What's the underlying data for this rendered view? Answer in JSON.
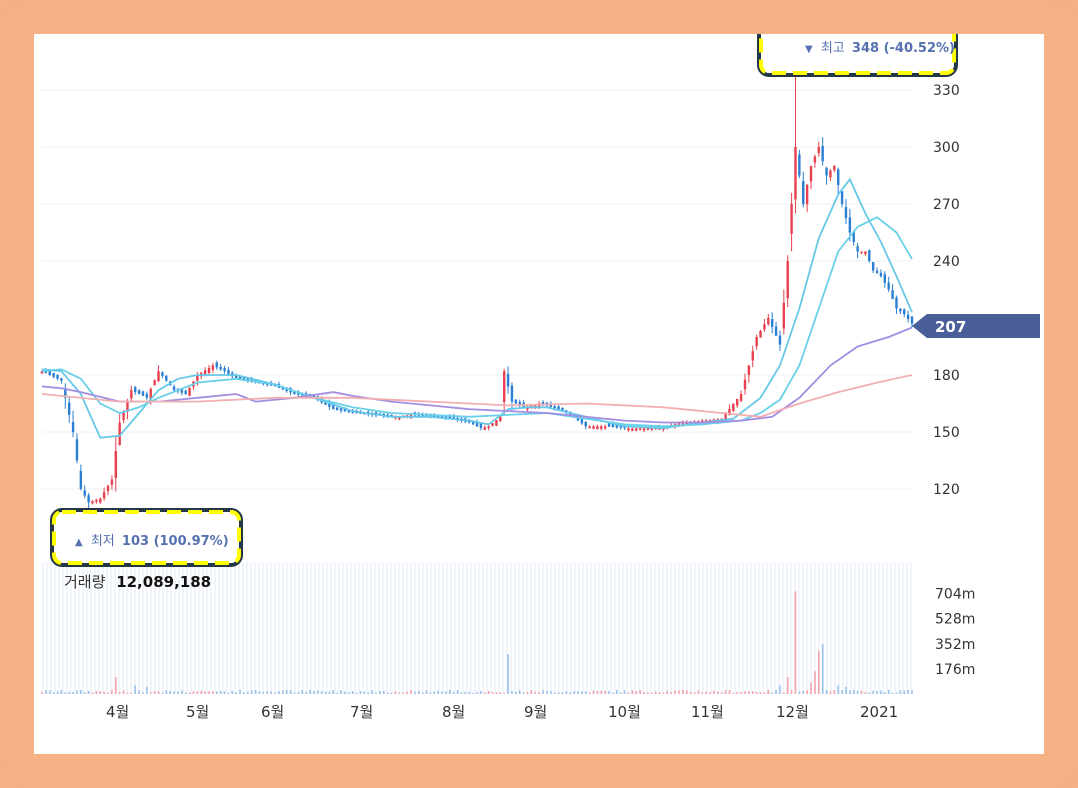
{
  "colors": {
    "up": "#e8404e",
    "down": "#2a7fd4",
    "ma_short": "#66c8e8",
    "ma_mid": "#68d0e8",
    "ma_long": "#a48ee2",
    "ma_xlong": "#f2aeb0",
    "price_tag": "#4a5f9a",
    "annotation_border": "#ffff00",
    "annotation_outline": "#243746",
    "annotation_text": "#5571b0",
    "volume_up": "#f4a3aa",
    "volume_down": "#9cc0ea",
    "frame": "#f4b183"
  },
  "annotations": {
    "high": {
      "marker": "▼",
      "label": "최고",
      "value": "348 (-40.52%)"
    },
    "low": {
      "marker": "▲",
      "label": "최저",
      "value": "103 (100.97%)"
    }
  },
  "current_price": "207",
  "volume": {
    "label": "거래량",
    "value": "12,089,188"
  },
  "chart_data": {
    "type": "candlestick",
    "x_labels": [
      "4월",
      "5월",
      "6월",
      "7월",
      "8월",
      "9월",
      "10월",
      "11월",
      "12월",
      "2021"
    ],
    "y_ticks": [
      120,
      150,
      180,
      240,
      270,
      300,
      330
    ],
    "y_tick_labels": [
      "120",
      "150",
      "180",
      "240",
      "270",
      "300",
      "330"
    ],
    "ylim": [
      100,
      350
    ],
    "volume_ticks": [
      176,
      352,
      528,
      704
    ],
    "volume_tick_labels": [
      "176m",
      "352m",
      "528m",
      "704m"
    ],
    "volume_ylim": [
      0,
      870
    ],
    "high": 348,
    "low": 103,
    "last": 207,
    "price_path": [
      [
        0,
        182
      ],
      [
        5,
        177
      ],
      [
        8,
        150
      ],
      [
        10,
        120
      ],
      [
        12,
        113
      ],
      [
        15,
        115
      ],
      [
        18,
        125
      ],
      [
        20,
        155
      ],
      [
        23,
        172
      ],
      [
        27,
        168
      ],
      [
        30,
        182
      ],
      [
        34,
        172
      ],
      [
        37,
        170
      ],
      [
        40,
        180
      ],
      [
        44,
        185
      ],
      [
        47,
        182
      ],
      [
        50,
        178
      ],
      [
        55,
        176
      ],
      [
        60,
        174
      ],
      [
        65,
        170
      ],
      [
        70,
        168
      ],
      [
        75,
        162
      ],
      [
        80,
        160
      ],
      [
        85,
        159
      ],
      [
        90,
        158
      ],
      [
        95,
        159
      ],
      [
        100,
        158
      ],
      [
        105,
        157
      ],
      [
        110,
        155
      ],
      [
        113,
        152
      ],
      [
        115,
        153
      ],
      [
        118,
        158
      ],
      [
        119,
        182
      ],
      [
        121,
        166
      ],
      [
        124,
        163
      ],
      [
        128,
        165
      ],
      [
        133,
        162
      ],
      [
        136,
        159
      ],
      [
        140,
        153
      ],
      [
        145,
        153
      ],
      [
        150,
        152
      ],
      [
        155,
        152
      ],
      [
        160,
        153
      ],
      [
        165,
        155
      ],
      [
        170,
        156
      ],
      [
        175,
        157
      ],
      [
        180,
        170
      ],
      [
        184,
        200
      ],
      [
        187,
        210
      ],
      [
        190,
        196
      ],
      [
        192,
        240
      ],
      [
        194,
        300
      ],
      [
        196,
        270
      ],
      [
        198,
        290
      ],
      [
        200,
        300
      ],
      [
        202,
        285
      ],
      [
        204,
        290
      ],
      [
        206,
        270
      ],
      [
        208,
        255
      ],
      [
        210,
        245
      ],
      [
        212,
        245
      ],
      [
        214,
        235
      ],
      [
        216,
        232
      ],
      [
        218,
        225
      ],
      [
        220,
        215
      ],
      [
        222,
        212
      ],
      [
        224,
        207
      ]
    ],
    "ma_short": [
      [
        0,
        183
      ],
      [
        5,
        182
      ],
      [
        10,
        170
      ],
      [
        15,
        147
      ],
      [
        20,
        148
      ],
      [
        25,
        160
      ],
      [
        30,
        172
      ],
      [
        35,
        178
      ],
      [
        40,
        180
      ],
      [
        50,
        180
      ],
      [
        60,
        175
      ],
      [
        70,
        168
      ],
      [
        80,
        161
      ],
      [
        90,
        158
      ],
      [
        100,
        158
      ],
      [
        110,
        156
      ],
      [
        115,
        154
      ],
      [
        120,
        162
      ],
      [
        125,
        163
      ],
      [
        130,
        163
      ],
      [
        140,
        158
      ],
      [
        150,
        153
      ],
      [
        160,
        152
      ],
      [
        170,
        155
      ],
      [
        178,
        157
      ],
      [
        185,
        168
      ],
      [
        190,
        185
      ],
      [
        195,
        215
      ],
      [
        200,
        252
      ],
      [
        205,
        275
      ],
      [
        208,
        283
      ],
      [
        212,
        265
      ],
      [
        216,
        250
      ],
      [
        220,
        232
      ],
      [
        224,
        213
      ]
    ],
    "ma_mid": [
      [
        0,
        182
      ],
      [
        5,
        183
      ],
      [
        10,
        178
      ],
      [
        15,
        165
      ],
      [
        20,
        160
      ],
      [
        25,
        163
      ],
      [
        30,
        168
      ],
      [
        40,
        176
      ],
      [
        50,
        178
      ],
      [
        60,
        175
      ],
      [
        70,
        168
      ],
      [
        80,
        163
      ],
      [
        90,
        160
      ],
      [
        100,
        159
      ],
      [
        110,
        158
      ],
      [
        120,
        159
      ],
      [
        130,
        160
      ],
      [
        140,
        157
      ],
      [
        150,
        154
      ],
      [
        160,
        153
      ],
      [
        170,
        154
      ],
      [
        180,
        156
      ],
      [
        185,
        160
      ],
      [
        190,
        167
      ],
      [
        195,
        185
      ],
      [
        200,
        215
      ],
      [
        205,
        245
      ],
      [
        210,
        258
      ],
      [
        215,
        263
      ],
      [
        220,
        255
      ],
      [
        224,
        241
      ]
    ],
    "ma_long": [
      [
        0,
        174
      ],
      [
        5,
        173
      ],
      [
        10,
        171
      ],
      [
        20,
        166
      ],
      [
        30,
        166
      ],
      [
        40,
        168
      ],
      [
        50,
        170
      ],
      [
        55,
        166
      ],
      [
        65,
        168
      ],
      [
        75,
        171
      ],
      [
        80,
        169
      ],
      [
        90,
        166
      ],
      [
        100,
        164
      ],
      [
        110,
        162
      ],
      [
        120,
        161
      ],
      [
        130,
        160
      ],
      [
        140,
        158
      ],
      [
        150,
        156
      ],
      [
        160,
        155
      ],
      [
        170,
        155
      ],
      [
        180,
        156
      ],
      [
        188,
        158
      ],
      [
        195,
        168
      ],
      [
        203,
        185
      ],
      [
        210,
        195
      ],
      [
        218,
        200
      ],
      [
        224,
        205
      ]
    ],
    "ma_xlong": [
      [
        0,
        170
      ],
      [
        20,
        166
      ],
      [
        40,
        166
      ],
      [
        60,
        168
      ],
      [
        80,
        168
      ],
      [
        100,
        166
      ],
      [
        120,
        164
      ],
      [
        140,
        165
      ],
      [
        160,
        163
      ],
      [
        175,
        160
      ],
      [
        185,
        158
      ],
      [
        195,
        165
      ],
      [
        205,
        171
      ],
      [
        215,
        176
      ],
      [
        224,
        180
      ]
    ],
    "volume_spikes": [
      [
        19,
        120
      ],
      [
        24,
        60
      ],
      [
        27,
        50
      ],
      [
        120,
        280
      ],
      [
        190,
        60
      ],
      [
        192,
        120
      ],
      [
        194,
        720
      ],
      [
        198,
        80
      ],
      [
        199,
        160
      ],
      [
        200,
        300
      ],
      [
        201,
        350
      ],
      [
        205,
        60
      ],
      [
        207,
        50
      ]
    ]
  }
}
